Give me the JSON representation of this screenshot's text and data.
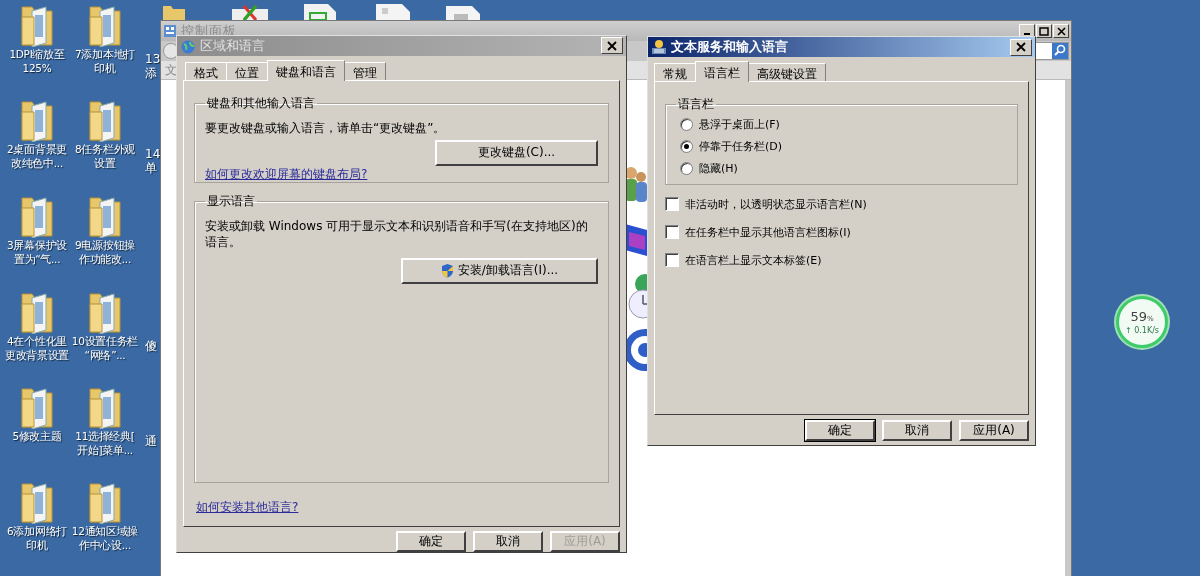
{
  "desktop_columns": [
    [
      {
        "label": [
          "1DPI缩放至",
          "125%"
        ]
      },
      {
        "label": [
          "2桌面背景更",
          "改纯色中..."
        ]
      },
      {
        "label": [
          "3屏幕保护设",
          "置为“气..."
        ]
      },
      {
        "label": [
          "4在个性化里",
          "更改背景设置"
        ]
      },
      {
        "label": [
          "5修改主题"
        ]
      },
      {
        "label": [
          "6添加网络打",
          "印机"
        ]
      }
    ],
    [
      {
        "label": [
          "7添加本地打",
          "印机"
        ]
      },
      {
        "label": [
          "8任务栏外观",
          "设置"
        ]
      },
      {
        "label": [
          "9电源按钮操",
          "作功能改..."
        ]
      },
      {
        "label": [
          "10设置任务栏",
          "“网络”..."
        ]
      },
      {
        "label": [
          "11选择经典[",
          "开始]菜单..."
        ]
      },
      {
        "label": [
          "12通知区域操",
          "作中心设..."
        ]
      }
    ],
    [
      {
        "label": [
          "13",
          "添"
        ]
      },
      {
        "label": [
          "14",
          "单"
        ]
      },
      {
        "label": [
          "傻"
        ]
      },
      {
        "label": [
          "通"
        ]
      }
    ]
  ],
  "control_panel": {
    "title": "控制面板",
    "menu_text": "文"
  },
  "region_dialog": {
    "title": "区域和语言",
    "tabs": [
      {
        "label": "格式",
        "selected": false
      },
      {
        "label": "位置",
        "selected": false
      },
      {
        "label": "键盘和语言",
        "selected": true
      },
      {
        "label": "管理",
        "selected": false
      }
    ],
    "keyboard_group": {
      "heading": "键盘和其他输入语言",
      "text": "要更改键盘或输入语言，请单击“更改键盘”。",
      "button": "更改键盘(C)...",
      "link": "如何更改欢迎屏幕的键盘布局?"
    },
    "display_group": {
      "heading": "显示语言",
      "text": "安装或卸载 Windows 可用于显示文本和识别语音和手写(在支持地区)的语言。",
      "button": "安装/卸载语言(I)..."
    },
    "link": "如何安装其他语言?",
    "buttons": [
      {
        "label": "确定",
        "disabled": false
      },
      {
        "label": "取消",
        "disabled": false
      },
      {
        "label": "应用(A)",
        "disabled": true
      }
    ]
  },
  "text_services_dialog": {
    "title": "文本服务和输入语言",
    "tabs": [
      {
        "label": "常规",
        "selected": false
      },
      {
        "label": "语言栏",
        "selected": true
      },
      {
        "label": "高级键设置",
        "selected": false
      }
    ],
    "group_heading": "语言栏",
    "options": [
      {
        "label": "悬浮于桌面上(F)",
        "selected": false
      },
      {
        "label": "停靠于任务栏(D)",
        "selected": true
      },
      {
        "label": "隐藏(H)",
        "selected": false
      }
    ],
    "checkboxes": [
      {
        "label": "非活动时，以透明状态显示语言栏(N)",
        "checked": false
      },
      {
        "label": "在任务栏中显示其他语言栏图标(I)",
        "checked": false
      },
      {
        "label": "在语言栏上显示文本标签(E)",
        "checked": false
      }
    ],
    "buttons": [
      {
        "label": "确定",
        "default": true
      },
      {
        "label": "取消",
        "default": false
      },
      {
        "label": "应用(A)",
        "default": false
      }
    ]
  },
  "network_widget": {
    "percent": "59",
    "unit": "%",
    "speed": "↑ 0.1K/s"
  }
}
